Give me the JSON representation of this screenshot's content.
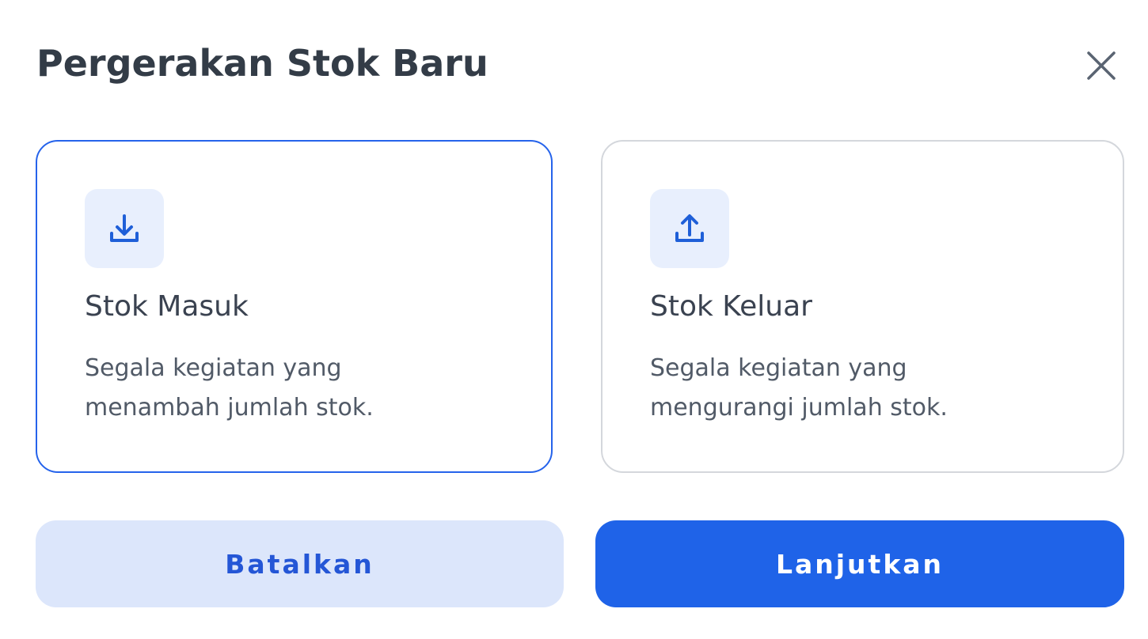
{
  "dialog": {
    "title": "Pergerakan Stok Baru",
    "close_icon": "close-icon"
  },
  "options": [
    {
      "icon": "download-icon",
      "title": "Stok Masuk",
      "description_lines": [
        "Segala kegiatan yang",
        "menambah jumlah stok."
      ],
      "selected": true
    },
    {
      "icon": "upload-icon",
      "title": "Stok Keluar",
      "description_lines": [
        "Segala kegiatan yang",
        "mengurangi jumlah stok."
      ],
      "selected": false
    }
  ],
  "buttons": {
    "cancel_label": "Batalkan",
    "continue_label": "Lanjutkan"
  },
  "colors": {
    "accent": "#1f63e8",
    "selected_border": "#2563eb",
    "icon_bg": "#e8effd",
    "cancel_bg": "#dce6fb",
    "title_text": "#333c47"
  }
}
